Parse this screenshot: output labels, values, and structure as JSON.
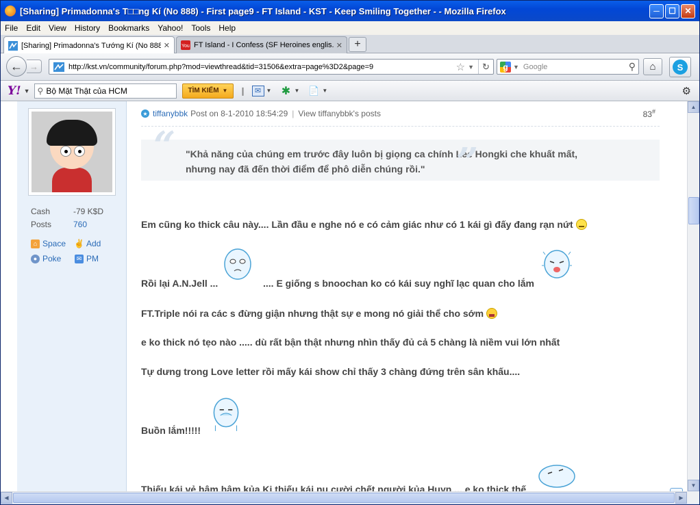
{
  "window": {
    "title": "[Sharing] Primadonna's T□□ng Kí (No 888) - First page9 - FT Island - KST - Keep Smiling Together - - Mozilla Firefox"
  },
  "menu": [
    "File",
    "Edit",
    "View",
    "History",
    "Bookmarks",
    "Yahoo!",
    "Tools",
    "Help"
  ],
  "tabs": [
    {
      "label": "[Sharing] Primadonna's Tướng Kí (No 888...",
      "close": "✕"
    },
    {
      "label": "FT Island - I Confess (SF Heroines englis...",
      "close": "✕"
    }
  ],
  "newtab": "+",
  "nav": {
    "url": "http://kst.vn/community/forum.php?mod=viewthread&tid=31506&extra=page%3D2&page=9",
    "search_placeholder": "Google"
  },
  "yahoo": {
    "search_value": "Bộ Mặt Thật của HCM",
    "button": "TÌM KIẾM"
  },
  "user": {
    "stats": [
      {
        "label": "Cash",
        "value": "-79 K$D"
      },
      {
        "label": "Posts",
        "value": "760"
      }
    ],
    "links": [
      "Space",
      "Add",
      "Poke",
      "PM"
    ]
  },
  "post": {
    "author": "tiffanybbk",
    "posted": "Post on 8-1-2010 18:54:29",
    "view_posts": "View tiffanybbk's posts",
    "number": "83",
    "number_sup": "#",
    "quote": [
      "\"Khả năng của chúng em trước đây luôn bị giọng ca chính Lee Hongki che khuất mất,",
      "nhưng nay đã đến thời điểm để phô diễn chúng rồi.\""
    ],
    "lines": [
      "Em cũng ko thick câu này.... Lần đầu e nghe nó e có cảm giác như có 1 kái gì đấy đang rạn nứt",
      "Rồi lại A.N.Jell ...",
      ".... E giống s bnoochan ko có kái suy nghĩ lạc quan cho lắm",
      "FT.Triple nói ra các s đừng giận  nhưng thật sự e mong nó giải thể cho sớm",
      "e ko thick nó tẹo nào ..... dù rất bận thật nhưng nhìn thấy đủ cả 5 chàng là niềm vui lớn nhất",
      "Tự dưng trong Love letter rồi mấy kái show chỉ thấy 3 chàng đứng trên sân khấu....",
      "Buồn lắm!!!!!",
      "Thiếu kái vẻ hâm hâm kủa Ki thiếu kái nu cười chết người kủa Huyn ... e ko thick thế"
    ]
  },
  "up_button": [
    "U",
    "P"
  ]
}
